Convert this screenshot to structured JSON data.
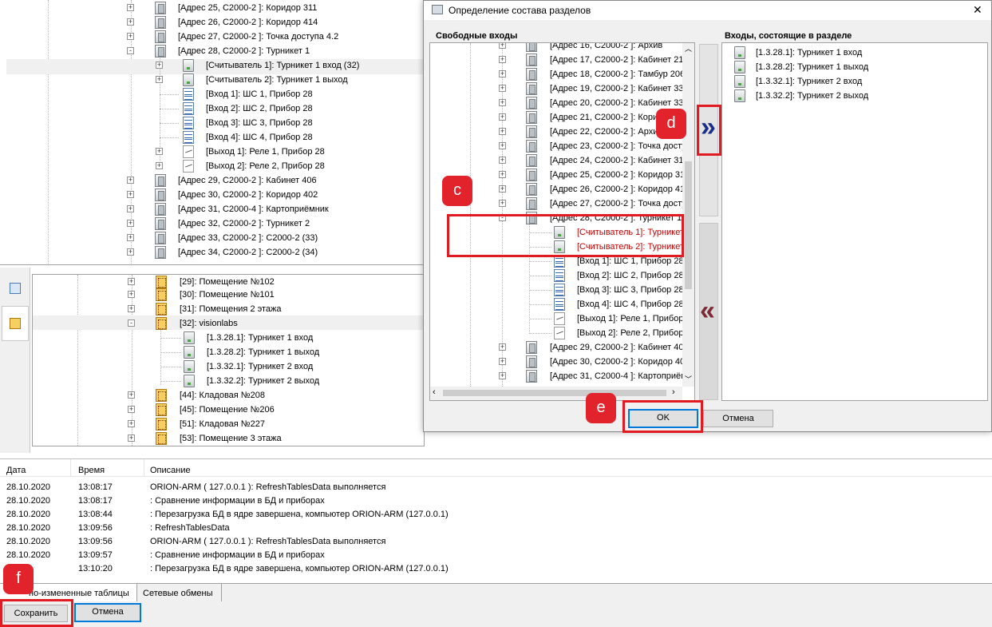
{
  "top_tree": {
    "items": [
      {
        "label": "[Адрес 25, С2000-2 ]: Коридор 311"
      },
      {
        "label": "[Адрес 26, С2000-2 ]: Коридор 414"
      },
      {
        "label": "[Адрес 27, С2000-2 ]: Точка доступа 4.2"
      },
      {
        "label": "[Адрес 28, С2000-2 ]: Турникет 1"
      },
      {
        "label": "[Считыватель 1]: Турникет 1 вход (32)"
      },
      {
        "label": "[Считыватель 2]: Турникет 1 выход"
      },
      {
        "label": "[Вход 1]: ШС 1, Прибор 28"
      },
      {
        "label": "[Вход 2]: ШС 2, Прибор 28"
      },
      {
        "label": "[Вход 3]: ШС 3, Прибор 28"
      },
      {
        "label": "[Вход 4]: ШС 4, Прибор 28"
      },
      {
        "label": "[Выход 1]: Реле 1, Прибор 28"
      },
      {
        "label": "[Выход 2]: Реле 2, Прибор 28"
      },
      {
        "label": "[Адрес 29, С2000-2 ]: Кабинет 406"
      },
      {
        "label": "[Адрес 30, С2000-2 ]: Коридор 402"
      },
      {
        "label": "[Адрес 31, С2000-4 ]: Картоприёмник"
      },
      {
        "label": "[Адрес 32, С2000-2 ]: Турникет 2"
      },
      {
        "label": "[Адрес 33, С2000-2 ]: С2000-2 (33)"
      },
      {
        "label": "[Адрес 34, С2000-2 ]: С2000-2 (34)"
      }
    ]
  },
  "zones_tree": {
    "items": [
      {
        "label": "[29]: Помещение №102"
      },
      {
        "label": "[30]: Помещение №101"
      },
      {
        "label": "[31]: Помещения 2 этажа"
      },
      {
        "label": "[32]: visionlabs"
      },
      {
        "label": "[1.3.28.1]: Турникет 1 вход"
      },
      {
        "label": "[1.3.28.2]: Турникет 1 выход"
      },
      {
        "label": "[1.3.32.1]: Турникет 2 вход"
      },
      {
        "label": "[1.3.32.2]: Турникет 2 выход"
      },
      {
        "label": "[44]: Кладовая №208"
      },
      {
        "label": "[45]: Помещение №206"
      },
      {
        "label": "[51]: Кладовая №227"
      },
      {
        "label": "[53]: Помещение 3 этажа"
      }
    ]
  },
  "dialog": {
    "title": "Определение состава разделов",
    "close_glyph": "✕",
    "left_header": "Свободные входы",
    "right_header": "Входы, состоящие в разделе",
    "add_glyph": "»",
    "remove_glyph": "«",
    "left_items": [
      {
        "label": "[Адрес 16, С2000-2 ]: Архив"
      },
      {
        "label": "[Адрес 17, С2000-2 ]: Кабинет 21"
      },
      {
        "label": "[Адрес 18, С2000-2 ]: Тамбур 206"
      },
      {
        "label": "[Адрес 19, С2000-2 ]: Кабинет 33"
      },
      {
        "label": "[Адрес 20, С2000-2 ]: Кабинет 33"
      },
      {
        "label": "[Адрес 21, С2000-2 ]: Кори"
      },
      {
        "label": "[Адрес 22, С2000-2 ]: Архи"
      },
      {
        "label": "[Адрес 23, С2000-2 ]: Точка досту"
      },
      {
        "label": "[Адрес 24, С2000-2 ]: Кабинет 31"
      },
      {
        "label": "[Адрес 25, С2000-2 ]: Коридор 31"
      },
      {
        "label": "[Адрес 26, С2000-2 ]: Коридор 41"
      },
      {
        "label": "[Адрес 27, С2000-2 ]: Точка досту"
      },
      {
        "label": "[Адрес 28, С2000-2 ]: Турникет 1"
      },
      {
        "label": "[Считыватель 1]: Турникет"
      },
      {
        "label": "[Считыватель 2]: Турникет"
      },
      {
        "label": "[Вход 1]: ШС 1, Прибор 28"
      },
      {
        "label": "[Вход 2]: ШС 2, Прибор 28"
      },
      {
        "label": "[Вход 3]: ШС 3, Прибор 28"
      },
      {
        "label": "[Вход 4]: ШС 4, Прибор 28"
      },
      {
        "label": "[Выход 1]: Реле 1, Прибор"
      },
      {
        "label": "[Выход 2]: Реле 2, Прибор"
      },
      {
        "label": "[Адрес 29, С2000-2 ]: Кабинет 40"
      },
      {
        "label": "[Адрес 30, С2000-2 ]: Коридор 40"
      },
      {
        "label": "[Адрес 31, С2000-4 ]: Картоприём"
      }
    ],
    "right_items": [
      {
        "label": "[1.3.28.1]: Турникет 1 вход"
      },
      {
        "label": "[1.3.28.2]: Турникет 1 выход"
      },
      {
        "label": "[1.3.32.1]: Турникет 2 вход"
      },
      {
        "label": "[1.3.32.2]: Турникет 2 выход"
      }
    ],
    "ok_label": "OK",
    "cancel_label": "Отмена"
  },
  "log": {
    "headers": {
      "date": "Дата",
      "time": "Время",
      "desc": "Описание"
    },
    "rows": [
      {
        "date": "28.10.2020",
        "time": "13:08:17",
        "desc": "ORION-ARM ( 127.0.0.1 ): RefreshTablesData выполняется"
      },
      {
        "date": "28.10.2020",
        "time": "13:08:17",
        "desc": ": Сравнение информации в БД и приборах"
      },
      {
        "date": "28.10.2020",
        "time": "13:08:44",
        "desc": ": Перезагрузка БД в ядре завершена, компьютер ORION-ARM (127.0.0.1)"
      },
      {
        "date": "28.10.2020",
        "time": "13:09:56",
        "desc": ": RefreshTablesData"
      },
      {
        "date": "28.10.2020",
        "time": "13:09:56",
        "desc": "ORION-ARM ( 127.0.0.1 ): RefreshTablesData выполняется"
      },
      {
        "date": "28.10.2020",
        "time": "13:09:57",
        "desc": ": Сравнение информации в БД и приборах"
      },
      {
        "date": "2020",
        "time": "13:10:20",
        "desc": ": Перезагрузка БД в ядре завершена, компьютер ORION-ARM (127.0.0.1)"
      }
    ]
  },
  "bottom_tabs": {
    "tab1": "но-измененные таблицы",
    "tab2": "Сетевые обмены"
  },
  "bottom_buttons": {
    "save": "Сохранить",
    "cancel": "Отмена"
  },
  "callouts": {
    "c": "c",
    "d": "d",
    "e": "e",
    "f": "f"
  },
  "colors": {
    "highlight_red": "#e21a22",
    "accent_blue": "#0078d7",
    "tree_red_text": "#c00000"
  }
}
